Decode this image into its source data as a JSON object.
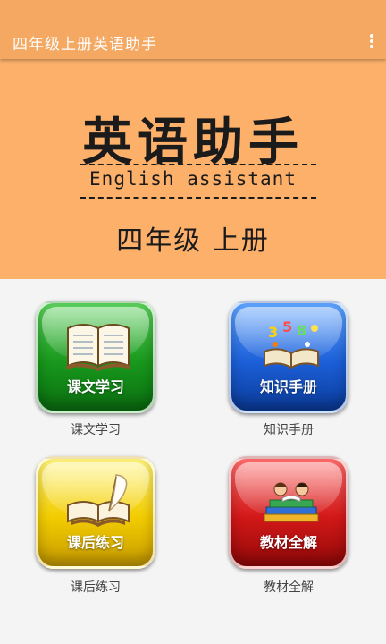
{
  "app_bar": {
    "title": "四年级上册英语助手",
    "menu_icon": "more-vert-icon"
  },
  "banner": {
    "title": "英语助手",
    "subtitle": "English assistant",
    "grade": "四年级  上册"
  },
  "tiles": [
    {
      "label": "课文学习",
      "caption": "课文学习",
      "icon": "open-book-icon",
      "color": "#1a9a1e"
    },
    {
      "label": "知识手册",
      "caption": "知识手册",
      "icon": "numbers-book-icon",
      "color": "#1c5fd8"
    },
    {
      "label": "课后练习",
      "caption": "课后练习",
      "icon": "book-quill-icon",
      "color": "#f2cc00"
    },
    {
      "label": "教材全解",
      "caption": "教材全解",
      "icon": "kids-reading-icon",
      "color": "#d21818"
    }
  ]
}
